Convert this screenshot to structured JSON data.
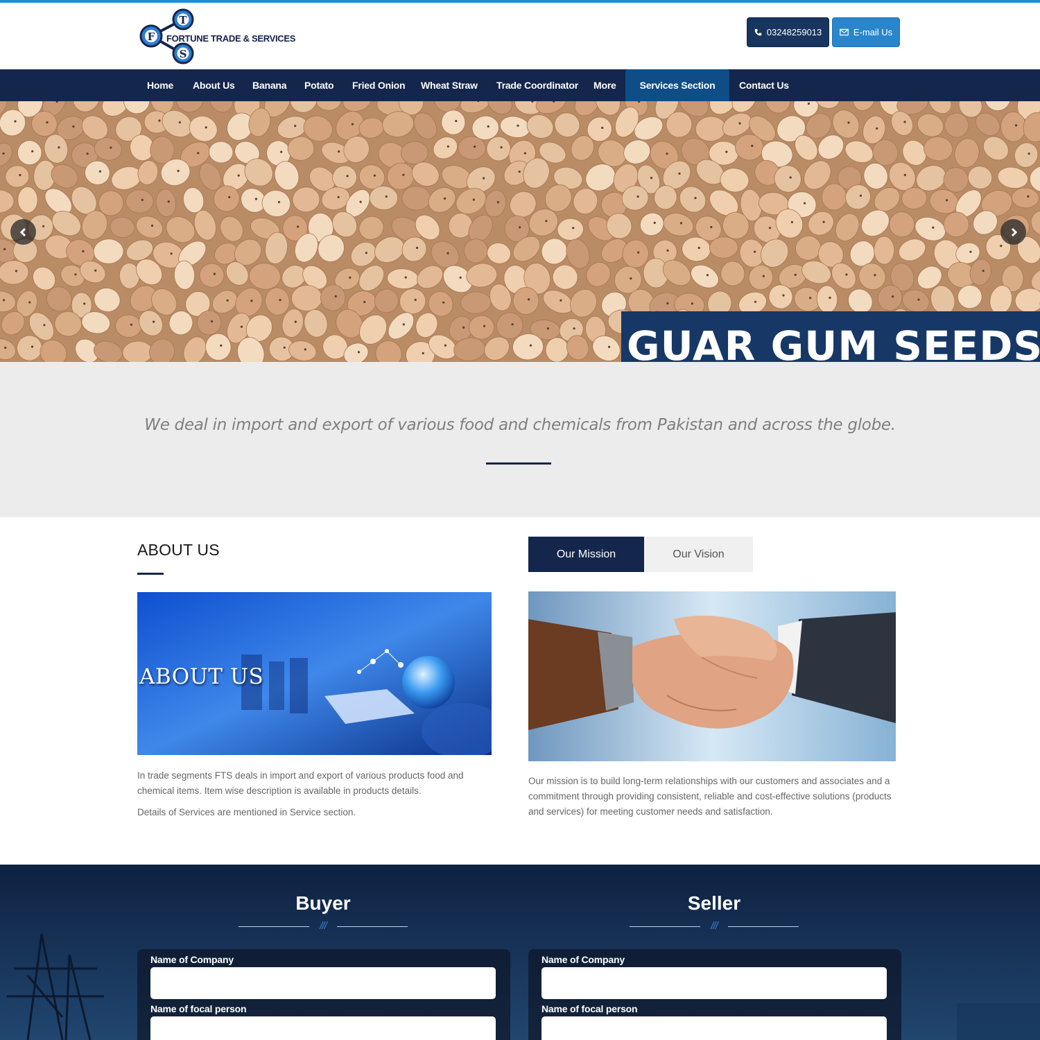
{
  "brand": {
    "logo_letters": [
      "F",
      "T",
      "S"
    ],
    "name": "FORTUNE TRADE & SERVICES",
    "primary_color": "#14264b",
    "accent_color": "#1b8fd8"
  },
  "header": {
    "phone_label": "03248259013",
    "email_label": "E-mail Us"
  },
  "nav": {
    "items": [
      {
        "label": "Home"
      },
      {
        "label": "About Us"
      },
      {
        "label": "Banana"
      },
      {
        "label": "Potato"
      },
      {
        "label": "Fried Onion"
      },
      {
        "label": "Wheat Straw"
      },
      {
        "label": "Trade Coordinator"
      },
      {
        "label": "More"
      },
      {
        "label": "Services Section",
        "active": true
      },
      {
        "label": "Contact Us"
      }
    ]
  },
  "hero": {
    "caption": "GUAR GUM SEEDS",
    "prev_icon": "chevron-left-icon",
    "next_icon": "chevron-right-icon"
  },
  "tagline": {
    "text": "We deal in import and export of various food and chemicals from Pakistan and across the globe."
  },
  "about": {
    "heading": "ABOUT US",
    "image_text": "ABOUT US",
    "paragraph_1": "In trade segments FTS deals in import and export of various products food and chemical items. Item wise description is available in products details.",
    "paragraph_2": "Details of Services are mentioned in Service section."
  },
  "mission": {
    "tabs": [
      {
        "label": "Our Mission",
        "active": true
      },
      {
        "label": "Our Vision",
        "active": false
      }
    ],
    "text": "Our mission is to build long-term relationships with our customers and associates and a commitment through providing consistent, reliable and cost-effective solutions (products and services) for meeting customer needs and satisfaction."
  },
  "forms": {
    "buyer": {
      "title": "Buyer",
      "divider": "///",
      "fields": [
        {
          "label": "Name of Company",
          "value": "",
          "placeholder": ""
        },
        {
          "label": "Name of focal person",
          "value": "",
          "placeholder": ""
        }
      ]
    },
    "seller": {
      "title": "Seller",
      "divider": "///",
      "fields": [
        {
          "label": "Name of Company",
          "value": "",
          "placeholder": ""
        },
        {
          "label": "Name of focal person",
          "value": "",
          "placeholder": ""
        }
      ]
    }
  }
}
